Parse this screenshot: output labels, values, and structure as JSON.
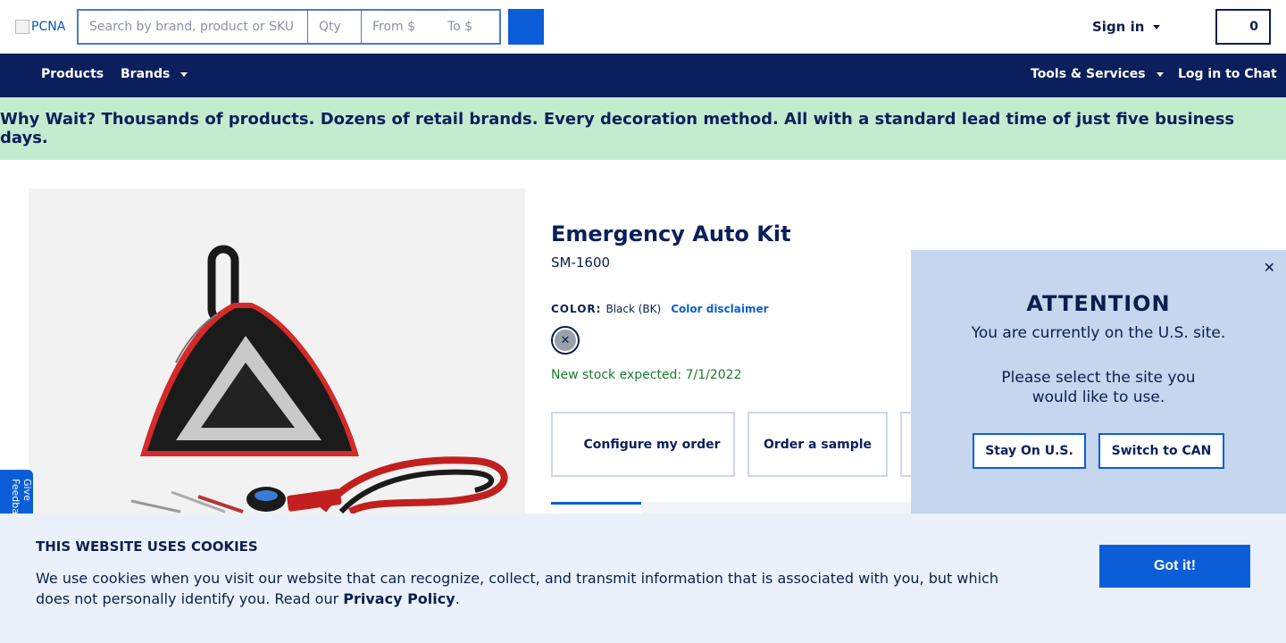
{
  "header": {
    "logo_alt": "PCNA",
    "search": {
      "placeholder": "Search by brand, product or SKU",
      "value": ""
    },
    "qty": {
      "placeholder": "Qty",
      "value": ""
    },
    "price_from": {
      "placeholder": "From $",
      "value": ""
    },
    "price_to": {
      "placeholder": "To $",
      "value": ""
    },
    "sign_in_label": "Sign in",
    "cart_count": "0"
  },
  "nav": {
    "products": "Products",
    "brands": "Brands",
    "tools_services": "Tools & Services",
    "chat": "Log in to Chat"
  },
  "promo": {
    "text": "Why Wait? Thousands of products. Dozens of retail brands. Every decoration method. All with a standard lead time of just five business days."
  },
  "product": {
    "title": "Emergency Auto Kit",
    "sku": "SM-1600",
    "color_label": "COLOR:",
    "color_value": "Black (BK)",
    "color_disclaimer": "Color disclaimer",
    "stock_text": "New stock expected: 7/1/2022",
    "actions": {
      "configure": "Configure my order",
      "sample": "Order a sample"
    }
  },
  "feedback": {
    "label": "Give Feedback"
  },
  "attention": {
    "title": "ATTENTION",
    "line1": "You are currently on the U.S. site.",
    "line2": "Please select the site you would like to use.",
    "stay_label": "Stay On U.S.",
    "switch_label": "Switch to CAN"
  },
  "cookie": {
    "title": "THIS WEBSITE USES COOKIES",
    "text": "We use cookies when you visit our website that can recognize, collect, and transmit information that is associated with you, but which does not personally identify you. Read our ",
    "link": "Privacy Policy",
    "end": ".",
    "button": "Got it!"
  },
  "colors": {
    "navy": "#0b1f5c",
    "accent_blue": "#0b5ed7",
    "promo_bg": "#c3eccf",
    "modal_bg": "#c5d6ee",
    "cookie_bg": "#eaf1fb",
    "stock_green": "#1b7a2e"
  }
}
